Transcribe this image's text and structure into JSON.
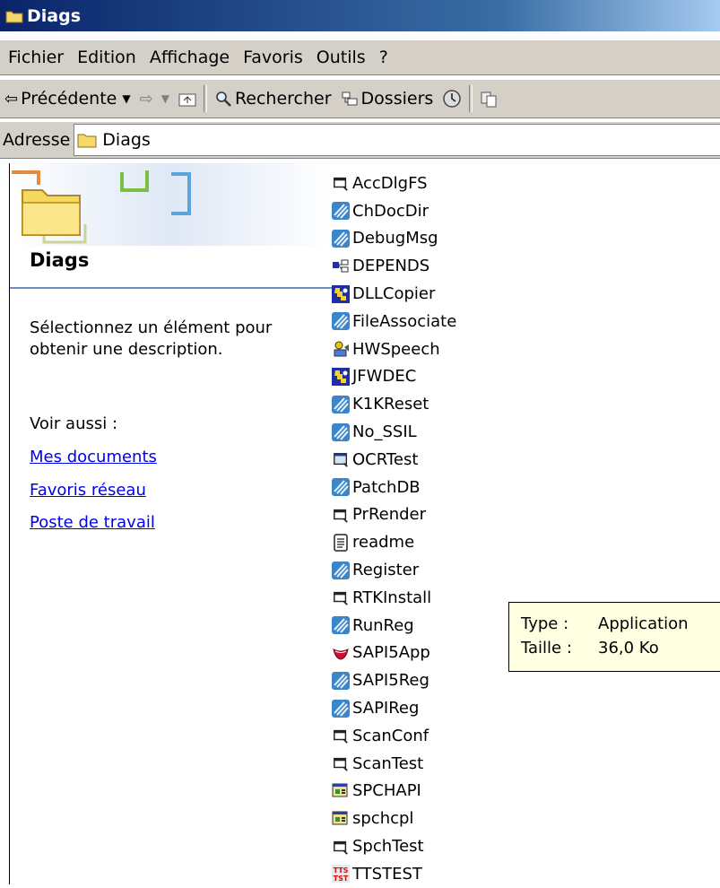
{
  "window": {
    "title": "Diags"
  },
  "menu": [
    "Fichier",
    "Edition",
    "Affichage",
    "Favoris",
    "Outils",
    "?"
  ],
  "toolbar": {
    "back_label": "Précédente",
    "search_label": "Rechercher",
    "folders_label": "Dossiers"
  },
  "address": {
    "label": "Adresse",
    "value": "Diags"
  },
  "taskpane": {
    "title": "Diags",
    "description": "Sélectionnez un élément pour obtenir une description.",
    "see_also": "Voir aussi :",
    "links": [
      "Mes documents",
      "Favoris réseau",
      "Poste de travail"
    ]
  },
  "files": [
    {
      "name": "AccDlgFS",
      "icon": "window-app-icon"
    },
    {
      "name": "ChDocDir",
      "icon": "installer-app-icon"
    },
    {
      "name": "DebugMsg",
      "icon": "installer-app-icon"
    },
    {
      "name": "DEPENDS",
      "icon": "dependency-walker-icon"
    },
    {
      "name": "DLLCopier",
      "icon": "blue-puzzle-app-icon"
    },
    {
      "name": "FileAssociate",
      "icon": "installer-app-icon"
    },
    {
      "name": "HWSpeech",
      "icon": "speech-app-icon"
    },
    {
      "name": "JFWDEC",
      "icon": "blue-puzzle-app-icon"
    },
    {
      "name": "K1KReset",
      "icon": "installer-app-icon"
    },
    {
      "name": "No_SSIL",
      "icon": "installer-app-icon"
    },
    {
      "name": "OCRTest",
      "icon": "window-app-alt-icon"
    },
    {
      "name": "PatchDB",
      "icon": "installer-app-icon"
    },
    {
      "name": "PrRender",
      "icon": "window-app-icon"
    },
    {
      "name": "readme",
      "icon": "text-document-icon"
    },
    {
      "name": "Register",
      "icon": "installer-app-icon"
    },
    {
      "name": "RTKInstall",
      "icon": "window-app-icon"
    },
    {
      "name": "RunReg",
      "icon": "installer-app-icon"
    },
    {
      "name": "SAPI5App",
      "icon": "red-lips-app-icon"
    },
    {
      "name": "SAPI5Reg",
      "icon": "installer-app-icon"
    },
    {
      "name": "SAPIReg",
      "icon": "installer-app-icon"
    },
    {
      "name": "ScanConf",
      "icon": "window-app-icon"
    },
    {
      "name": "ScanTest",
      "icon": "window-app-icon"
    },
    {
      "name": "SPCHAPI",
      "icon": "control-panel-icon"
    },
    {
      "name": "spchcpl",
      "icon": "control-panel-icon"
    },
    {
      "name": "SpchTest",
      "icon": "window-app-icon"
    },
    {
      "name": "TTSTEST",
      "icon": "tts-app-icon"
    }
  ],
  "tooltip": {
    "type_label": "Type :",
    "type_value": "Application",
    "size_label": "Taille :",
    "size_value": "36,0 Ko"
  },
  "colors": {
    "titlebar_start": "#0a246a",
    "titlebar_end": "#a6caf0",
    "chrome": "#d4d0c8",
    "link": "#0000ee",
    "tooltip_bg": "#ffffe1"
  }
}
